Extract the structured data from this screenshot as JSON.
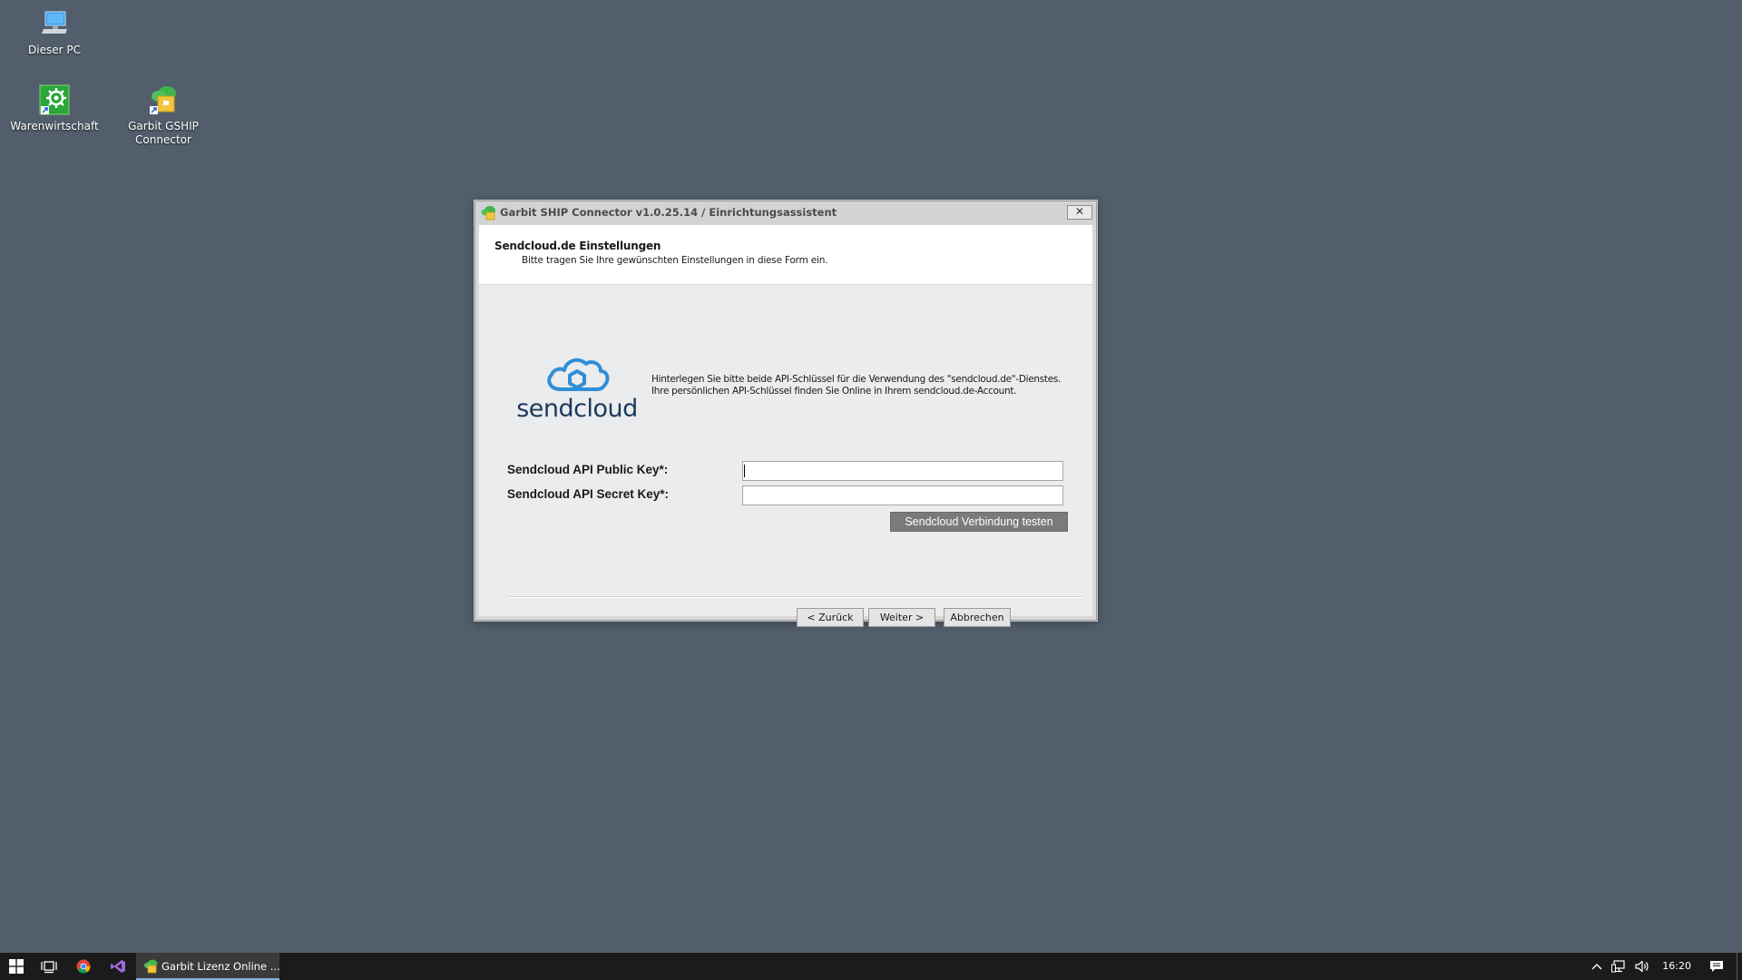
{
  "desktop": {
    "icons": [
      {
        "label": "Dieser PC",
        "icon": "pc-icon"
      },
      {
        "label": "Warenwirtschaft",
        "icon": "warenwirtschaft-icon"
      },
      {
        "label_line1": "Garbit GSHIP",
        "label_line2": "Connector",
        "icon": "gship-connector-icon"
      }
    ]
  },
  "dialog": {
    "title": "Garbit SHIP Connector v1.0.25.14 / Einrichtungsassistent",
    "close_label": "✕",
    "header": {
      "title": "Sendcloud.de Einstellungen",
      "subtitle": "Bitte tragen Sie Ihre gewünschten Einstellungen in diese Form ein."
    },
    "logo_text": "sendcloud",
    "info_line1": "Hinterlegen Sie bitte beide API-Schlüssel für die Verwendung des \"sendcloud.de\"-Dienstes.",
    "info_line2": "Ihre persönlichen API-Schlüssel finden Sie Online in Ihrem sendcloud.de-Account.",
    "fields": {
      "public_key_label": "Sendcloud API Public Key*:",
      "public_key_value": "",
      "secret_key_label": "Sendcloud API Secret Key*:",
      "secret_key_value": ""
    },
    "test_button": "Sendcloud Verbindung testen",
    "buttons": {
      "back": "< Zurück",
      "next": "Weiter >",
      "cancel": "Abbrechen"
    }
  },
  "taskbar": {
    "active_app_label": "Garbit Lizenz Online ...",
    "clock": "16:20"
  },
  "colors": {
    "desktop": "#525e6c",
    "sendcloud_blue": "#2e8fd8",
    "sendcloud_text": "#1b3a5c",
    "taskbar": "#1b1b1b"
  }
}
